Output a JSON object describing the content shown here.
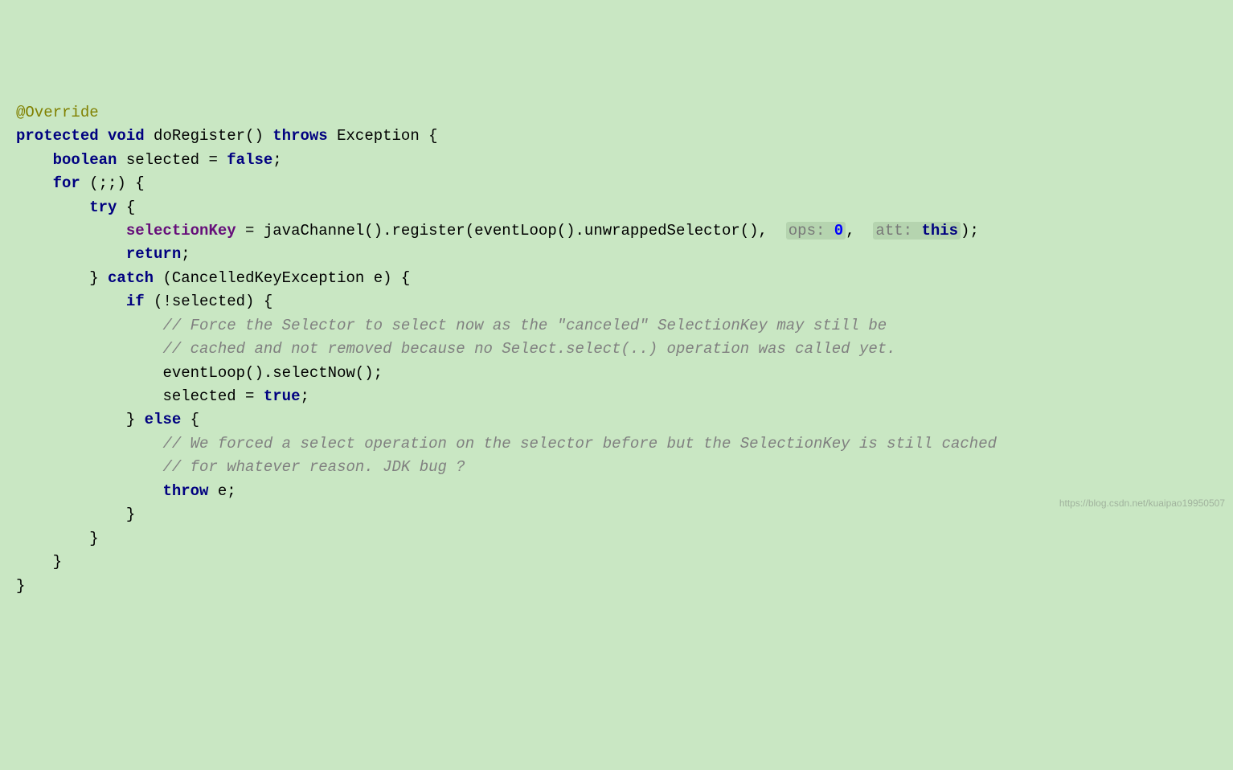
{
  "code": {
    "l1": {
      "annotation": "@Override"
    },
    "l2": {
      "kw1": "protected",
      "kw2": "void",
      "method": "doRegister()",
      "kw3": "throws",
      "exc": "Exception {"
    },
    "l3": {
      "kw1": "boolean",
      "var": "selected =",
      "kw2": "false",
      "semi": ";"
    },
    "l4": {
      "kw1": "for",
      "rest": " (;;) {"
    },
    "l5": {
      "kw1": "try",
      "rest": " {"
    },
    "l6": {
      "field": "selectionKey",
      "eq": " = javaChannel().register(eventLoop().unwrappedSelector(),  ",
      "hint1": "ops: ",
      "num": "0",
      "comma": ",  ",
      "hint2": "att: ",
      "kw": "this",
      "end": ");"
    },
    "l7": {
      "kw1": "return",
      "semi": ";"
    },
    "l8": {
      "brace": "} ",
      "kw1": "catch",
      "rest": " (CancelledKeyException e) {"
    },
    "l9": {
      "kw1": "if",
      "rest": " (!selected) {"
    },
    "l10": {
      "comment": "// Force the Selector to select now as the \"canceled\" SelectionKey may still be"
    },
    "l11": {
      "comment": "// cached and not removed because no Select.select(..) operation was called yet."
    },
    "l12": {
      "text": "eventLoop().selectNow();"
    },
    "l13": {
      "text": "selected = ",
      "kw": "true",
      "semi": ";"
    },
    "l14": {
      "brace": "} ",
      "kw1": "else",
      "rest": " {"
    },
    "l15": {
      "comment": "// We forced a select operation on the selector before but the SelectionKey is still cached"
    },
    "l16": {
      "comment": "// for whatever reason. JDK bug ?"
    },
    "l17": {
      "kw1": "throw",
      "rest": " e;"
    },
    "l18": {
      "brace": "}"
    },
    "l19": {
      "brace": "}"
    },
    "l20": {
      "brace": "}"
    },
    "l21": {
      "brace": "}"
    }
  },
  "watermark": "https://blog.csdn.net/kuaipao19950507"
}
